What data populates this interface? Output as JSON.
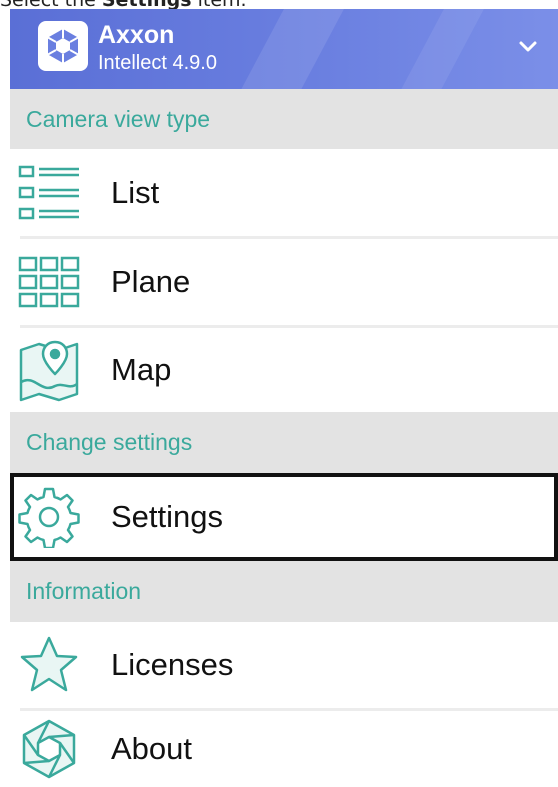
{
  "caption": {
    "prefix": "Select the ",
    "bold": "Settings",
    "suffix": " item."
  },
  "header": {
    "brand": "Axxon",
    "version": "Intellect 4.9.0"
  },
  "sections": {
    "camera_view_type": "Camera view type",
    "change_settings": "Change settings",
    "information": "Information"
  },
  "items": {
    "list": "List",
    "plane": "Plane",
    "map": "Map",
    "settings": "Settings",
    "licenses": "Licenses",
    "about": "About"
  },
  "colors": {
    "accent": "#3aa99c",
    "header_bg": "#6a7fe0",
    "section_bg": "#e3e3e3",
    "selection_border": "#111111"
  },
  "icons": {
    "logo": "axxon-logo-icon",
    "chevron": "chevron-down-icon",
    "list": "list-view-icon",
    "plane": "grid-view-icon",
    "map": "map-pin-icon",
    "settings": "gear-icon",
    "licenses": "star-icon",
    "about": "hexagon-logo-icon"
  }
}
